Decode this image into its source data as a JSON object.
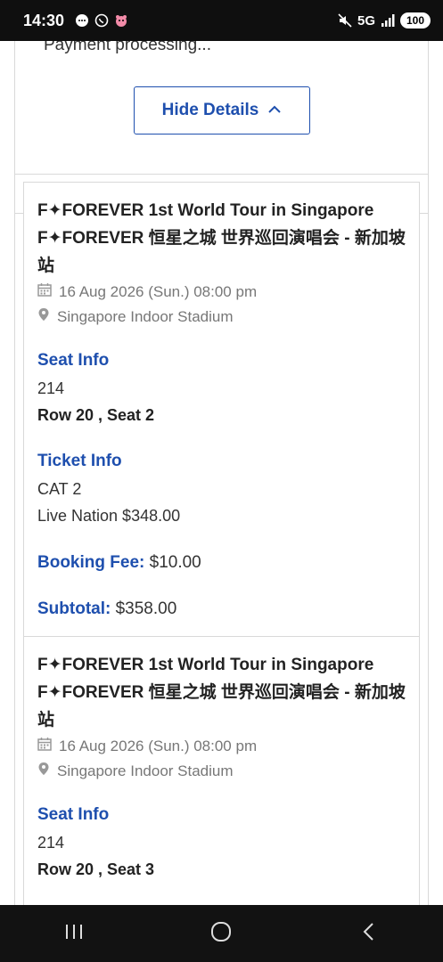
{
  "status_bar": {
    "time": "14:30",
    "network": "5G",
    "battery": "100",
    "icons": [
      "message-icon",
      "whatsapp-icon",
      "app-notification-icon",
      "mute-icon",
      "signal-icon"
    ]
  },
  "payment_status": "Payment processing...",
  "details_toggle": {
    "label": "Hide Details",
    "icon": "chevron-up-icon"
  },
  "tickets": [
    {
      "title_en": "F✦FOREVER 1st World Tour in Singapore",
      "title_cn": "F✦FOREVER 恒星之城 世界巡回演唱会 - 新加坡站",
      "date": "16 Aug 2026 (Sun.) 08:00 pm",
      "venue": "Singapore Indoor Stadium",
      "seat_info_label": "Seat Info",
      "section": "214",
      "row_seat": "Row 20 , Seat 2",
      "ticket_info_label": "Ticket Info",
      "category": "CAT 2",
      "price_line": "Live Nation $348.00",
      "booking_fee_label": "Booking Fee:",
      "booking_fee": "$10.00",
      "subtotal_label": "Subtotal:",
      "subtotal": "$358.00"
    },
    {
      "title_en": "F✦FOREVER 1st World Tour in Singapore",
      "title_cn": "F✦FOREVER 恒星之城 世界巡回演唱会 - 新加坡站",
      "date": "16 Aug 2026 (Sun.) 08:00 pm",
      "venue": "Singapore Indoor Stadium",
      "seat_info_label": "Seat Info",
      "section": "214",
      "row_seat": "Row 20 , Seat 3"
    }
  ],
  "colors": {
    "accent": "#1e4fae",
    "muted": "#777777",
    "border": "#d9d9d9"
  },
  "nav_bar": {
    "buttons": [
      "recents-icon",
      "home-icon",
      "back-icon"
    ]
  }
}
